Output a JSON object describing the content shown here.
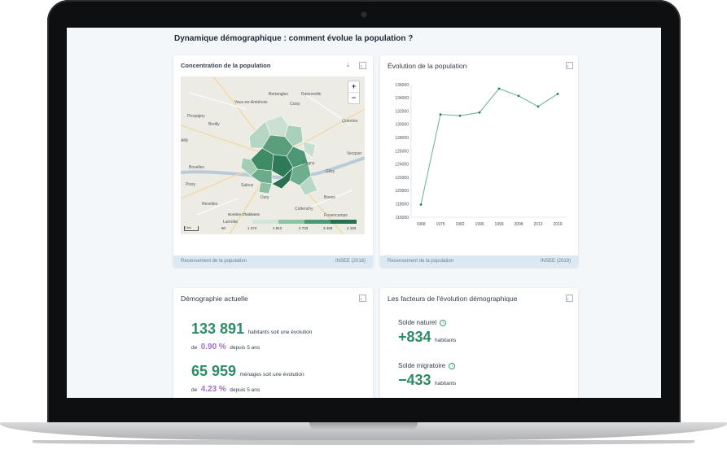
{
  "page": {
    "heading": "Dynamique démographique : comment évolue la population ?"
  },
  "colors": {
    "accent_green": "#2e8b64",
    "accent_purple": "#a46ec8",
    "source_band": "#dbe9f3"
  },
  "map_card": {
    "title": "Concentration de la population",
    "icons": [
      "download-icon",
      "chart-icon"
    ],
    "zoom_in": "+",
    "zoom_out": "−",
    "towns": [
      "Bertangles",
      "Rainneville",
      "Vaux-en-Amiénois",
      "Coisy",
      "Picquigny",
      "Querrieu",
      "Breilly",
      "Ailly",
      "Vecquer",
      "Bovelles",
      "Saleux",
      "Pissy",
      "Dury",
      "Boves",
      "Revelles",
      "Cottenchy",
      "Fouencamps",
      "Glisy",
      "Cagny",
      "Lamotte"
    ],
    "legend_title": "Nombre d'habitants",
    "legend_ticks": [
      "90",
      "1 274",
      "1 812",
      "2 733",
      "3 409",
      "4 183"
    ],
    "scale_label": "3 km",
    "source_left": "Recensement de la population",
    "source_right": "INSEE (2018)"
  },
  "evolution_card": {
    "title": "Évolution de la population",
    "source_left": "Recensement de la population",
    "source_right": "INSEE (2019)"
  },
  "chart_data": {
    "type": "line",
    "title": "Évolution de la population",
    "x": [
      "1968",
      "1975",
      "1982",
      "1990",
      "1999",
      "2008",
      "2013",
      "2019"
    ],
    "series": [
      {
        "values": [
          117900,
          131500,
          131300,
          131800,
          135400,
          134300,
          132700,
          134600
        ]
      }
    ],
    "ylim": [
      116000,
      136000
    ],
    "yticks": [
      "116000",
      "118000",
      "120000",
      "122000",
      "124000",
      "126000",
      "128000",
      "130000",
      "132000",
      "134000",
      "136000"
    ],
    "grid": false,
    "color": "#64b28f"
  },
  "demo_card": {
    "title": "Démographie actuelle",
    "population_value": "133 891",
    "population_text": "habitants soit une évolution",
    "population_prefix": "de",
    "population_pct": "0.90 %",
    "population_suffix": "depuis 5 ans",
    "households_value": "65 959",
    "households_text": "ménages soit une évolution",
    "households_prefix": "de",
    "households_pct": "4.23 %",
    "households_suffix": "depuis 5 ans"
  },
  "factors_card": {
    "title": "Les facteurs de l'évolution démographique",
    "natural_label": "Solde naturel",
    "natural_value": "+834",
    "natural_unit": "habitants",
    "migration_label": "Solde migratoire",
    "migration_value": "−433",
    "migration_unit": "habitants",
    "info_glyph": "i"
  }
}
